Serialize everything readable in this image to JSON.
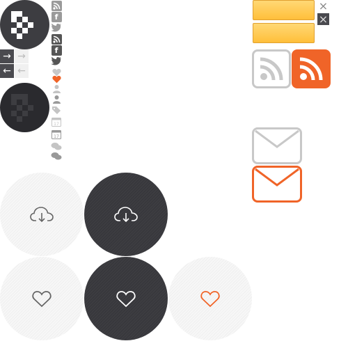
{
  "theme": {
    "dark": "#3d3d41",
    "orange": "#f06428",
    "gray_icon": "#999999",
    "light_gray": "#c8c8c8",
    "yellow": "#ffc84a"
  },
  "logo": {
    "name": "pixel-logo",
    "variants": [
      "dark",
      "darker"
    ]
  },
  "arrows": {
    "right_glyph": "→",
    "left_glyph": "←"
  },
  "social_icons": [
    {
      "name": "rss-icon",
      "glyph": "◉"
    },
    {
      "name": "facebook-icon",
      "glyph": "f"
    },
    {
      "name": "twitter-icon",
      "glyph": "🐦"
    },
    {
      "name": "rss-icon-hover",
      "glyph": "◉"
    },
    {
      "name": "facebook-icon-hover",
      "glyph": "f"
    },
    {
      "name": "twitter-icon-hover",
      "glyph": "🐦"
    },
    {
      "name": "heart-icon-gray",
      "glyph": "♥"
    },
    {
      "name": "heart-icon-orange",
      "glyph": "♥"
    },
    {
      "name": "user-icon-light",
      "glyph": "👤"
    },
    {
      "name": "user-icon-dark",
      "glyph": "👤"
    },
    {
      "name": "tags-icon",
      "glyph": "🏷"
    },
    {
      "name": "calendar-icon-light",
      "glyph": "17"
    },
    {
      "name": "calendar-icon-dark",
      "glyph": "17"
    },
    {
      "name": "comments-icon-light",
      "glyph": "💬"
    },
    {
      "name": "comments-icon-dark",
      "glyph": "💬"
    }
  ],
  "round_buttons": [
    {
      "name": "download-cloud-button-light",
      "icon": "cloud-download-icon"
    },
    {
      "name": "download-cloud-button-dark",
      "icon": "cloud-download-icon"
    },
    {
      "name": "heart-button-light",
      "icon": "heart-icon"
    },
    {
      "name": "heart-button-dark",
      "icon": "heart-icon"
    },
    {
      "name": "heart-button-active",
      "icon": "heart-icon"
    }
  ],
  "close_glyph": "×",
  "big_icons": [
    {
      "name": "rss-large-gray",
      "icon": "rss-icon"
    },
    {
      "name": "rss-large-orange",
      "icon": "rss-icon"
    },
    {
      "name": "mail-large-gray",
      "icon": "mail-icon"
    },
    {
      "name": "mail-large-orange",
      "icon": "mail-icon"
    }
  ]
}
